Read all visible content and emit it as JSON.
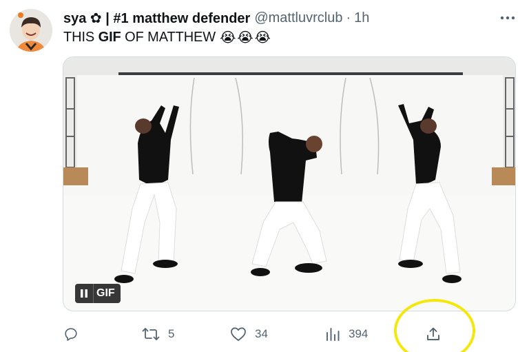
{
  "tweet": {
    "display_name": "sya ✿ | #1 matthew defender",
    "handle": "@mattluvrclub",
    "separator": "·",
    "time": "1h",
    "text_prefix": "THIS ",
    "text_bold": "GIF",
    "text_suffix": " OF MATTHEW",
    "emoji": [
      "😭",
      "😭",
      "😭"
    ]
  },
  "media": {
    "type": "gif",
    "badge_label": "GIF",
    "pause_icon": "pause-icon"
  },
  "actions": {
    "reply": {
      "icon": "reply-icon",
      "count": ""
    },
    "retweet": {
      "icon": "retweet-icon",
      "count": "5"
    },
    "like": {
      "icon": "heart-icon",
      "count": "34"
    },
    "views": {
      "icon": "views-icon",
      "count": "394"
    },
    "share": {
      "icon": "share-icon"
    }
  },
  "colors": {
    "text": "#0f1419",
    "secondary": "#536471",
    "highlight_circle": "#f4e80a"
  }
}
